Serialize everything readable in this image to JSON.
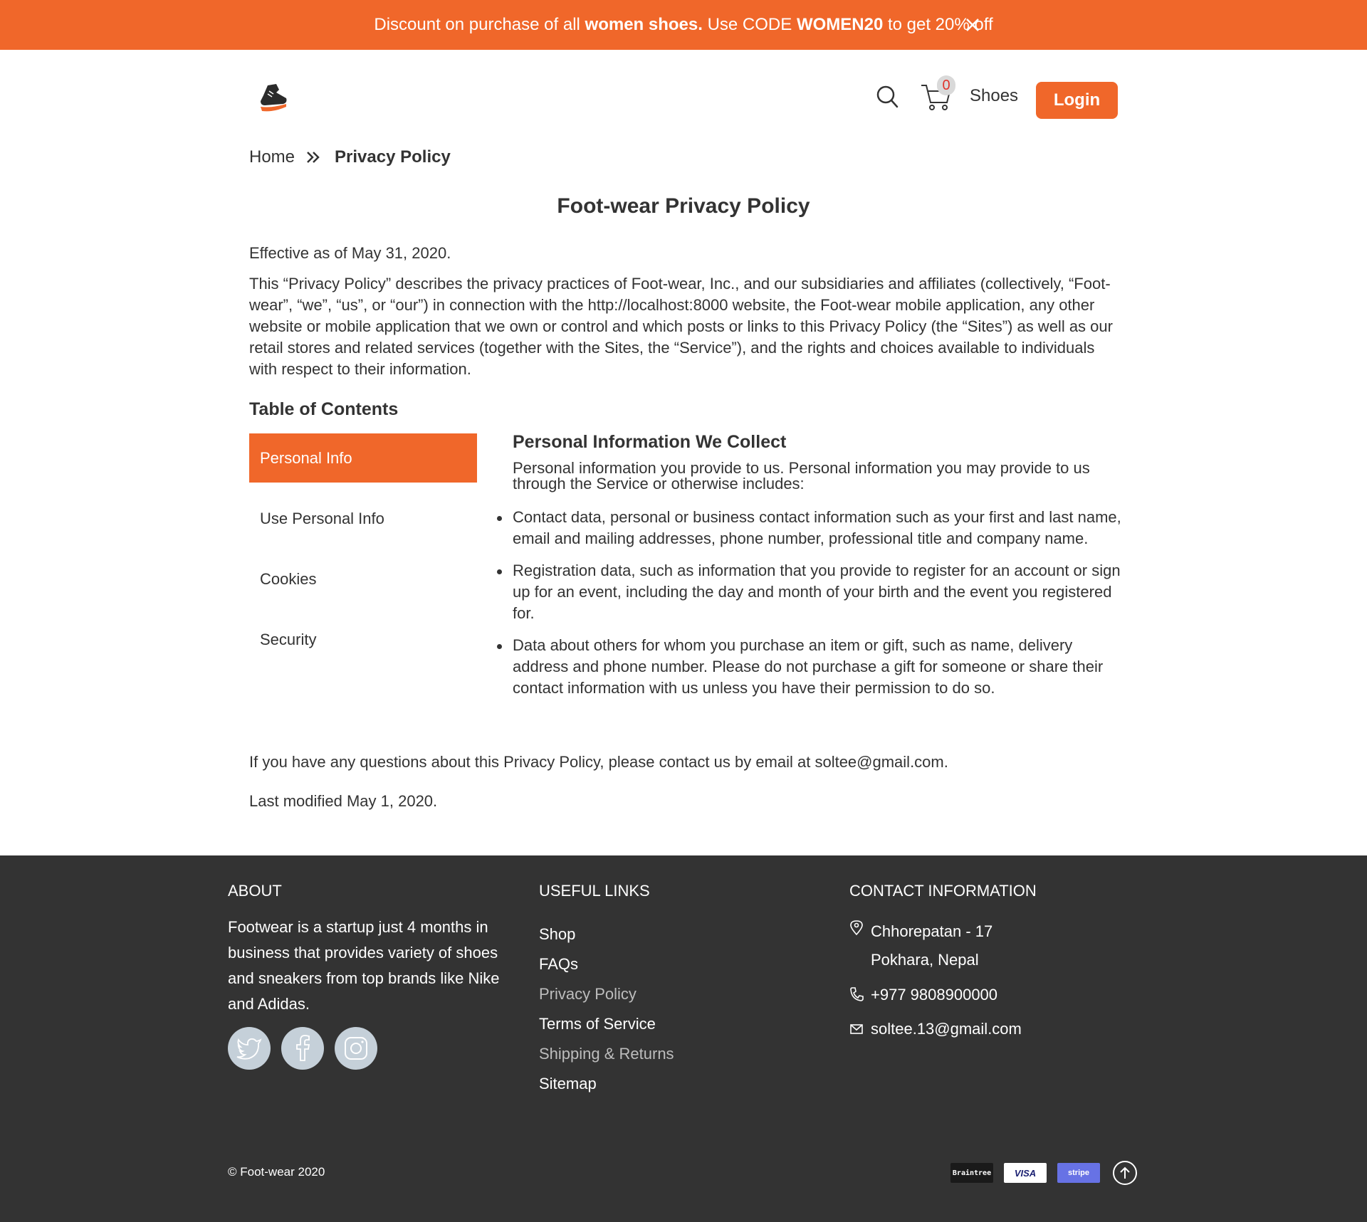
{
  "promo": {
    "text_1": "Discount on purchase of all ",
    "text_bold_1": "women shoes.",
    "text_2": " Use CODE ",
    "text_bold_2": "WOMEN20",
    "text_3": " to get 20% off",
    "close_icon": "close-icon"
  },
  "header": {
    "logo_icon": "sneaker-logo-icon",
    "search_icon": "search-icon",
    "cart_icon": "cart-icon",
    "cart_count": "0",
    "shoes_label": "Shoes",
    "login_label": "Login"
  },
  "breadcrumb": {
    "home": "Home",
    "separator_icon": "double-chevron-right-icon",
    "current": "Privacy Policy"
  },
  "content": {
    "title": "Foot-wear Privacy Policy",
    "effective": "Effective as of May 31, 2020.",
    "intro": "This “Privacy Policy” describes the privacy practices of Foot-wear, Inc., and our subsidiaries and affiliates (collectively, “Foot-wear”, “we”, “us”, or “our”) in connection with the http://localhost:8000 website, the Foot-wear mobile application, any other website or mobile application that we own or control and which posts or links to this Privacy Policy (the “Sites”) as well as our retail stores and related services (together with the Sites, the “Service”), and the rights and choices available to individuals with respect to their information.",
    "toc_title": "Table of Contents",
    "toc": [
      {
        "label": "Personal Info",
        "active": true
      },
      {
        "label": "Use Personal Info",
        "active": false
      },
      {
        "label": "Cookies",
        "active": false
      },
      {
        "label": "Security",
        "active": false
      }
    ],
    "section_title": "Personal Information We Collect",
    "section_intro": "Personal information you provide to us. Personal information you may provide to us through the Service or otherwise includes:",
    "bullets": [
      "Contact data, personal or business contact information such as your first and last name, email and mailing addresses, phone number, professional title and company name.",
      "Registration data, such as information that you provide to register for an account or sign up for an event, including the day and month of your birth and the event you registered for.",
      "Data about others for whom you purchase an item or gift, such as name, delivery address and phone number. Please do not purchase a gift for someone or share their contact information with us unless you have their permission to do so."
    ],
    "questions": "If you have any questions about this Privacy Policy, please contact us by email at soltee@gmail.com.",
    "modified": "Last modified May 1, 2020."
  },
  "footer": {
    "about_heading": "ABOUT",
    "about_text": "Footwear is a startup just 4 months in business that provides variety of shoes and sneakers from top brands like Nike and Adidas.",
    "social": [
      "twitter-icon",
      "facebook-icon",
      "instagram-icon"
    ],
    "links_heading": "USEFUL LINKS",
    "links": [
      "Shop",
      "FAQs",
      "Privacy Policy",
      "Terms of Service",
      "Shipping & Returns",
      "Sitemap"
    ],
    "contact_heading": "CONTACT INFORMATION",
    "address_line_1": "Chhorepatan - 17",
    "address_line_2": "Pokhara, Nepal",
    "phone": "+977 9808900000",
    "email": "soltee.13@gmail.com",
    "copyright": "© Foot-wear 2020",
    "payments": [
      "Braintree",
      "VISA",
      "stripe"
    ],
    "to_top_icon": "arrow-up-circle-icon"
  },
  "colors": {
    "accent": "#f0672a",
    "footer_bg": "#333333",
    "text": "#333333"
  }
}
